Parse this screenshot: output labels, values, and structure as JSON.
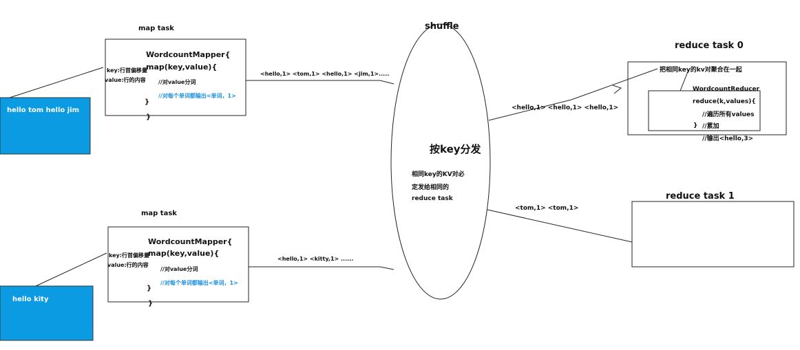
{
  "colors": {
    "input_box": "#0a9be2",
    "comment_blue": "#1a8fe0",
    "stroke": "#222222"
  },
  "inputs": [
    {
      "text": "hello tom  hello jim"
    },
    {
      "text": "hello kity"
    }
  ],
  "map_tasks": [
    {
      "title": "map task",
      "key_note": "key:行首偏移量",
      "value_note": "value:行的内容",
      "class_line": "WordcountMapper{",
      "method_line": "map(key,value){",
      "comment1": "//对value分词",
      "comment2": "//对每个单词都输出<单词，1>",
      "close1": "}",
      "close2": "}",
      "output": "<hello,1> <tom,1> <hello,1>  <jim,1>....."
    },
    {
      "title": "map task",
      "key_note": "key:行首偏移量",
      "value_note": "value:行的内容",
      "class_line": "WordcountMapper{",
      "method_line": "map(key,value){",
      "comment1": "//对value分词",
      "comment2": "//对每个单词都输出<单词，1>",
      "close1": "}",
      "close2": "}",
      "output": "<hello,1>  <kitty,1>  ......"
    }
  ],
  "shuffle": {
    "title": "shuffle",
    "heading": "按key分发",
    "desc": [
      "相同key的KV对必",
      "定发给相同的",
      "reduce task"
    ]
  },
  "reduce_tasks": [
    {
      "title": "reduce task  0",
      "input": "<hello,1> <hello,1> <hello,1>",
      "note": "把相同key的kv对聚合在一起",
      "class_line": "WordcountReducer",
      "method_line": "reduce(k,values){",
      "comment1": "//遍历所有values",
      "comment2": "//累加",
      "comment3": "//输出<hello,3>",
      "close": "}"
    },
    {
      "title": "reduce task    1",
      "input": "<tom,1> <tom,1>"
    }
  ]
}
